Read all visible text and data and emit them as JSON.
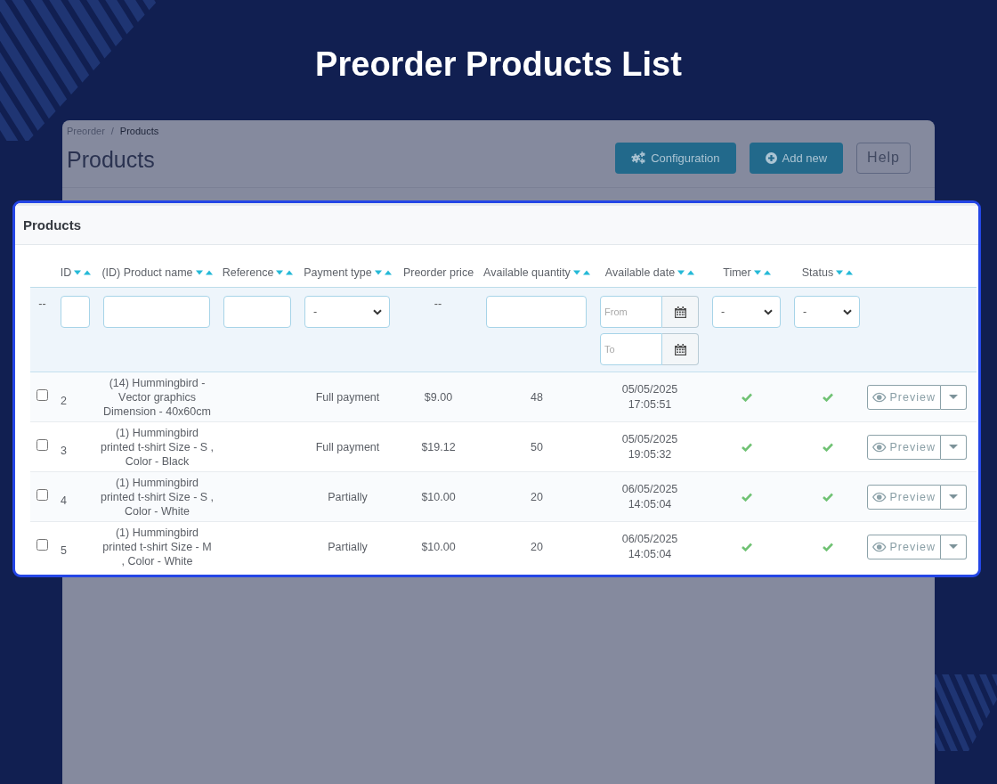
{
  "page_title": "Preorder Products List",
  "admin": {
    "breadcrumb": [
      {
        "label": "Preorder",
        "current": false
      },
      {
        "label": "Products",
        "current": true
      }
    ],
    "breadcrumb_separator": "/",
    "title": "Products",
    "buttons": [
      {
        "label": "Configuration",
        "kind": "configure"
      },
      {
        "label": "Add new",
        "kind": "add"
      },
      {
        "label": "Help",
        "kind": "help"
      }
    ]
  },
  "panel": {
    "title": "Products",
    "columns": [
      {
        "label": "ID",
        "sortable": true
      },
      {
        "label": "(ID) Product name",
        "sortable": true
      },
      {
        "label": "Reference",
        "sortable": true
      },
      {
        "label": "Payment type",
        "sortable": true
      },
      {
        "label": "Preorder price",
        "sortable": false
      },
      {
        "label": "Available quantity",
        "sortable": true
      },
      {
        "label": "Available date",
        "sortable": true
      },
      {
        "label": "Timer",
        "sortable": true
      },
      {
        "label": "Status",
        "sortable": true
      }
    ],
    "filters": [
      {
        "kind": "text",
        "text": "--"
      },
      {
        "kind": "input"
      },
      {
        "kind": "input"
      },
      {
        "kind": "input"
      },
      {
        "kind": "select",
        "value": "-"
      },
      {
        "kind": "text",
        "text": "--"
      },
      {
        "kind": "input"
      },
      {
        "kind": "date_range",
        "from_placeholder": "From",
        "to_placeholder": "To"
      },
      {
        "kind": "select",
        "value": "-"
      },
      {
        "kind": "select",
        "value": "-"
      }
    ],
    "rows": [
      {
        "checked": false,
        "id": "2",
        "product": "(14) Hummingbird - Vector graphics Dimension - 40x60cm",
        "payment_type": "Full payment",
        "price": "$9.00",
        "quantity": "48",
        "date": "05/05/2025",
        "time": "17:05:51",
        "timer": true,
        "status": true,
        "action": "Preview"
      },
      {
        "checked": false,
        "id": "3",
        "product": "(1) Hummingbird printed t-shirt Size - S , Color - Black",
        "payment_type": "Full payment",
        "price": "$19.12",
        "quantity": "50",
        "date": "05/05/2025",
        "time": "19:05:32",
        "timer": true,
        "status": true,
        "action": "Preview"
      },
      {
        "checked": false,
        "id": "4",
        "product": "(1) Hummingbird printed t-shirt Size - S , Color - White",
        "payment_type": "Partially",
        "price": "$10.00",
        "quantity": "20",
        "date": "06/05/2025",
        "time": "14:05:04",
        "timer": true,
        "status": true,
        "action": "Preview"
      },
      {
        "checked": false,
        "id": "5",
        "product": "(1) Hummingbird printed t-shirt Size - M , Color - White",
        "payment_type": "Partially",
        "price": "$10.00",
        "quantity": "20",
        "date": "06/05/2025",
        "time": "14:05:04",
        "timer": true,
        "status": true,
        "action": "Preview"
      }
    ]
  }
}
